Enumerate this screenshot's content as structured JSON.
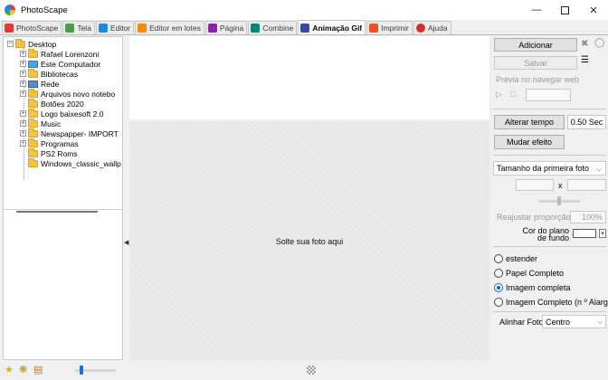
{
  "window": {
    "title": "PhotoScape"
  },
  "tabs": [
    {
      "label": "PhotoScape",
      "icon": "photoscape-icon",
      "color": "#e53935",
      "active": false
    },
    {
      "label": "Tela",
      "icon": "viewer-icon",
      "color": "#43a047",
      "active": false
    },
    {
      "label": "Editor",
      "icon": "editor-icon",
      "color": "#1e88e5",
      "active": false
    },
    {
      "label": "Editor em lotes",
      "icon": "batch-editor-icon",
      "color": "#fb8c00",
      "active": false
    },
    {
      "label": "Página",
      "icon": "page-icon",
      "color": "#8e24aa",
      "active": false
    },
    {
      "label": "Combine",
      "icon": "combine-icon",
      "color": "#00897b",
      "active": false
    },
    {
      "label": "Animação Gif",
      "icon": "gif-animation-icon",
      "color": "#3949ab",
      "active": true
    },
    {
      "label": "Imprimir",
      "icon": "print-icon",
      "color": "#f4511e",
      "active": false
    },
    {
      "label": "Ajuda",
      "icon": "help-icon",
      "color": "#d32f2f",
      "active": false
    }
  ],
  "tree": {
    "root": "Desktop",
    "items": [
      {
        "label": "Rafael Lorenzoni",
        "icon": "folder-icon",
        "expandable": true
      },
      {
        "label": "Este Computador",
        "icon": "monitor-icon",
        "expandable": true
      },
      {
        "label": "Bibliotecas",
        "icon": "folder-icon",
        "expandable": true
      },
      {
        "label": "Rede",
        "icon": "network-icon",
        "expandable": true
      },
      {
        "label": "Arquivos novo notebo",
        "icon": "folder-icon",
        "expandable": true
      },
      {
        "label": "Botões 2020",
        "icon": "folder-icon",
        "expandable": false
      },
      {
        "label": "Logo baixesoft 2.0",
        "icon": "folder-icon",
        "expandable": true
      },
      {
        "label": "Music",
        "icon": "folder-icon",
        "expandable": true
      },
      {
        "label": "Newspapper- IMPORT",
        "icon": "folder-icon",
        "expandable": true
      },
      {
        "label": "Programas",
        "icon": "folder-icon",
        "expandable": true
      },
      {
        "label": "PS2 Roms",
        "icon": "folder-icon",
        "expandable": false
      },
      {
        "label": "Windows_classic_wallp",
        "icon": "folder-icon",
        "expandable": false
      }
    ]
  },
  "center": {
    "drop_label": "Solte sua foto aqui"
  },
  "right": {
    "add_label": "Adicionar",
    "save_label": "Salvar",
    "browser_preview_label": "Prévia no navegar web",
    "change_time_label": "Alterar tempo",
    "time_value": "0.50 Sec",
    "change_effect_label": "Mudar efeito",
    "size_select_value": "Tamanho da primeira foto",
    "size_separator": "x",
    "readjust_label": "Reajustar proporção",
    "readjust_value": "100%",
    "bg_color_label": "Cor do plano de fundo",
    "bg_color": "#ffffff",
    "radio_options": [
      {
        "label": "estender",
        "checked": false
      },
      {
        "label": "Papel Completo",
        "checked": false
      },
      {
        "label": "Imagem completa",
        "checked": true
      },
      {
        "label": "Imagem Completo (n º Alarga",
        "checked": false
      }
    ],
    "align_label": "Alinhar Foto",
    "align_value": "Centro"
  },
  "colors": {
    "accent": "#0a64c8",
    "folder": "#f5c342"
  }
}
